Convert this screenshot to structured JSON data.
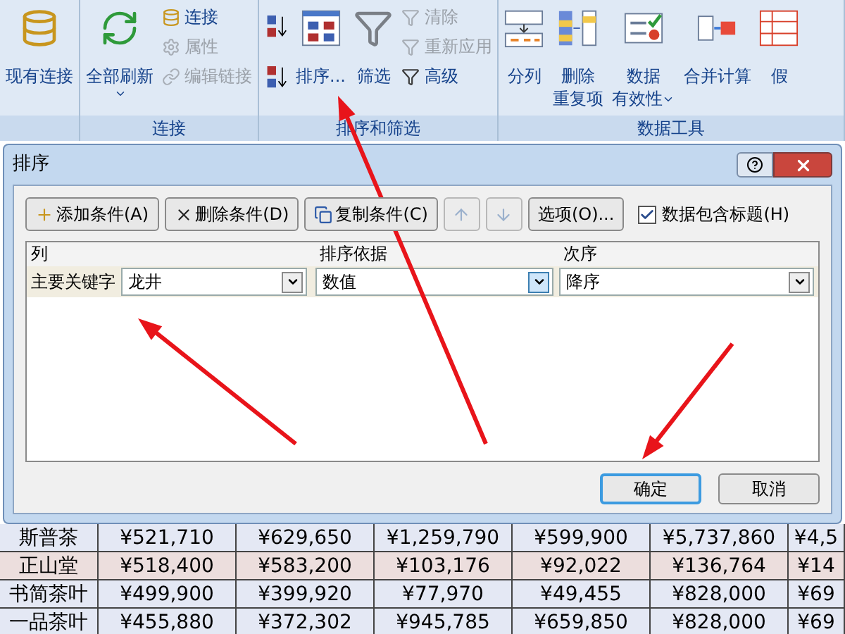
{
  "ribbon": {
    "groups": [
      {
        "items": [
          {
            "kind": "large",
            "lines": [
              "现有连接"
            ],
            "disabled": false
          }
        ]
      },
      {
        "label": "连接",
        "items": [
          {
            "kind": "large",
            "lines": [
              "全部刷新"
            ],
            "dropdown": true,
            "disabled": false
          },
          {
            "kind": "small",
            "lines": [
              "连接"
            ],
            "disabled": false
          },
          {
            "kind": "small",
            "lines": [
              "属性"
            ],
            "disabled": true
          },
          {
            "kind": "small",
            "lines": [
              "编辑链接"
            ],
            "disabled": true
          }
        ]
      },
      {
        "label": "排序和筛选",
        "items": [
          {
            "kind": "sortpair"
          },
          {
            "kind": "large",
            "lines": [
              "排序..."
            ],
            "disabled": false
          },
          {
            "kind": "large",
            "lines": [
              "筛选"
            ],
            "disabled": false
          },
          {
            "kind": "small",
            "lines": [
              "清除"
            ],
            "disabled": true
          },
          {
            "kind": "small",
            "lines": [
              "重新应用"
            ],
            "disabled": true
          },
          {
            "kind": "small",
            "lines": [
              "高级"
            ],
            "disabled": false
          }
        ]
      },
      {
        "label": "数据工具",
        "items": [
          {
            "kind": "large",
            "lines": [
              "分列"
            ],
            "disabled": false
          },
          {
            "kind": "large",
            "lines": [
              "删除",
              "重复项"
            ],
            "disabled": false
          },
          {
            "kind": "large",
            "lines": [
              "数据",
              "有效性"
            ],
            "dropdown": true,
            "disabled": false
          },
          {
            "kind": "large",
            "lines": [
              "合并计算"
            ],
            "disabled": false
          },
          {
            "kind": "large",
            "lines": [
              "假"
            ],
            "disabled": false
          }
        ]
      }
    ]
  },
  "dialog": {
    "title": "排序",
    "toolbar": [
      {
        "kind": "button",
        "label": "添加条件(A)",
        "disabled": false
      },
      {
        "kind": "button",
        "label": "删除条件(D)",
        "disabled": false
      },
      {
        "kind": "button",
        "label": "复制条件(C)",
        "disabled": false
      },
      {
        "kind": "arrow",
        "disabled": true
      },
      {
        "kind": "arrow",
        "disabled": true
      },
      {
        "kind": "button",
        "label": "选项(O)...",
        "disabled": false
      }
    ],
    "header_checkbox": {
      "label": "数据包含标题(H)",
      "checked": true
    },
    "columns": [
      "列",
      "排序依据",
      "次序"
    ],
    "rows": [
      {
        "label": "主要关键字",
        "selected": true,
        "column": "龙井",
        "sort_on": "数值",
        "order": "降序"
      }
    ],
    "buttons": [
      {
        "label": "确定",
        "default": true
      },
      {
        "label": "取消",
        "default": false
      }
    ]
  },
  "sheet": {
    "rows": [
      {
        "color": "#e4e8f4",
        "cells": [
          "斯普茶",
          "¥521,710",
          "¥629,650",
          "¥1,259,790",
          "¥599,900",
          "¥5,737,860",
          "¥4,5"
        ]
      },
      {
        "color": "#ecdedd",
        "cells": [
          "正山堂",
          "¥518,400",
          "¥583,200",
          "¥103,176",
          "¥92,022",
          "¥136,764",
          "¥14"
        ]
      },
      {
        "color": "#e4e8f4",
        "cells": [
          "书简茶叶",
          "¥499,900",
          "¥399,920",
          "¥77,970",
          "¥49,455",
          "¥828,000",
          "¥69"
        ]
      },
      {
        "color": "#e4e8f4",
        "cells": [
          "一品茶叶",
          "¥455,880",
          "¥372,302",
          "¥945,785",
          "¥659,850",
          "¥828,000",
          "¥69"
        ]
      }
    ]
  }
}
